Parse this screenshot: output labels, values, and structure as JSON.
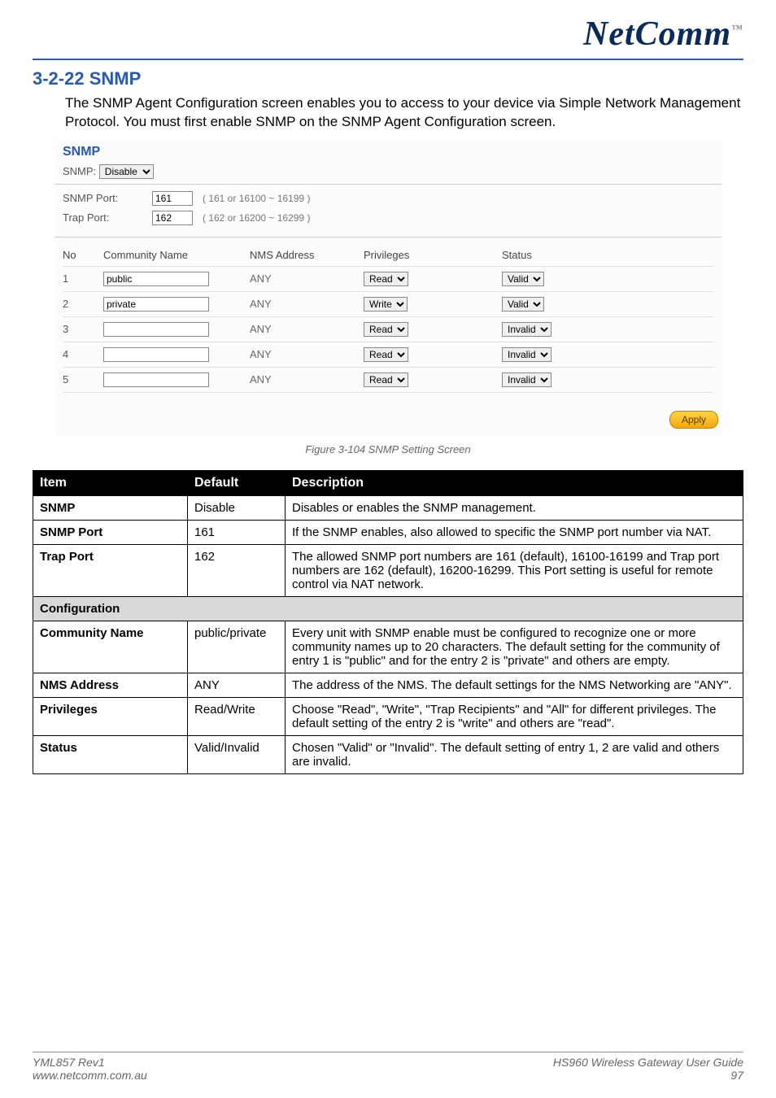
{
  "logo": {
    "text": "NetComm",
    "tm": "™"
  },
  "section_title": "3-2-22 SNMP",
  "intro": "The SNMP Agent Configuration screen enables you to access to your device via Simple Network Management Protocol. You must first enable SNMP on the SNMP Agent Configuration screen.",
  "panel": {
    "title": "SNMP",
    "select_label": "SNMP:",
    "select_value": "Disable",
    "snmp_port_label": "SNMP Port:",
    "snmp_port_value": "161",
    "snmp_port_hint": "( 161 or 16100 ~ 16199 )",
    "trap_port_label": "Trap Port:",
    "trap_port_value": "162",
    "trap_port_hint": "( 162 or 16200 ~ 16299 )",
    "headers": {
      "no": "No",
      "community": "Community Name",
      "nms": "NMS Address",
      "priv": "Privileges",
      "status": "Status"
    },
    "rows": [
      {
        "no": "1",
        "community": "public",
        "nms": "ANY",
        "priv": "Read",
        "status": "Valid"
      },
      {
        "no": "2",
        "community": "private",
        "nms": "ANY",
        "priv": "Write",
        "status": "Valid"
      },
      {
        "no": "3",
        "community": "",
        "nms": "ANY",
        "priv": "Read",
        "status": "Invalid"
      },
      {
        "no": "4",
        "community": "",
        "nms": "ANY",
        "priv": "Read",
        "status": "Invalid"
      },
      {
        "no": "5",
        "community": "",
        "nms": "ANY",
        "priv": "Read",
        "status": "Invalid"
      }
    ],
    "apply": "Apply"
  },
  "figure_caption": "Figure 3-104 SNMP Setting Screen",
  "table": {
    "headers": {
      "item": "Item",
      "default": "Default",
      "description": "Description"
    },
    "rows": [
      {
        "item": "SNMP",
        "default": "Disable",
        "desc": "Disables or enables the SNMP management."
      },
      {
        "item": "SNMP Port",
        "default": "161",
        "desc": "If the SNMP enables, also allowed to specific the SNMP port number via NAT."
      },
      {
        "item": "Trap Port",
        "default": "162",
        "desc": "The allowed SNMP port numbers are 161 (default), 16100-16199 and Trap port numbers are 162 (default), 16200-16299. This Port setting is useful for remote control via NAT network."
      }
    ],
    "config_label": "Configuration",
    "config_rows": [
      {
        "item": "Community Name",
        "default": "public/private",
        "desc": "Every unit with SNMP enable must be configured to recognize one or more community names up to 20 characters. The default setting for the community of entry 1 is \"public\" and for the entry 2 is \"private\" and others are empty."
      },
      {
        "item": "NMS Address",
        "default": "ANY",
        "desc": "The address of the NMS. The default settings for the NMS Networking are \"ANY\"."
      },
      {
        "item": "Privileges",
        "default": "Read/Write",
        "desc": "Choose \"Read\", \"Write\", \"Trap Recipients\" and \"All\" for different privileges. The default setting of the entry 2 is \"write\" and others are \"read\"."
      },
      {
        "item": "Status",
        "default": "Valid/Invalid",
        "desc": "Chosen \"Valid\" or \"Invalid\". The default setting of entry 1, 2 are valid and others are invalid."
      }
    ]
  },
  "footer": {
    "left1": "YML857 Rev1",
    "left2": "www.netcomm.com.au",
    "right1": "HS960 Wireless Gateway User Guide",
    "right2": "97"
  }
}
